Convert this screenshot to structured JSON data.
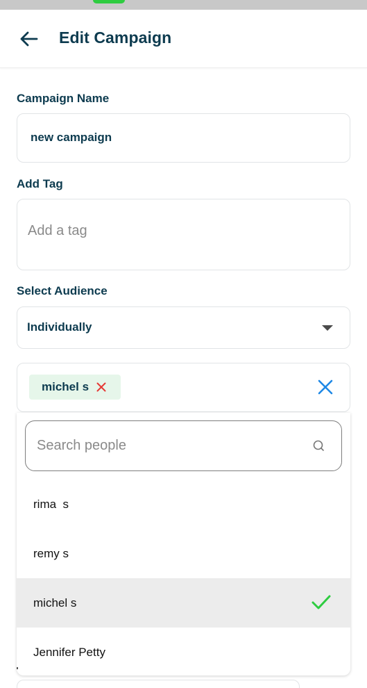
{
  "header": {
    "title": "Edit Campaign",
    "back_icon": "arrow-left-icon"
  },
  "form": {
    "campaign_name": {
      "label": "Campaign Name",
      "value": "new campaign"
    },
    "tag": {
      "label": "Add Tag",
      "placeholder": "Add a tag"
    },
    "audience": {
      "label": "Select Audience",
      "selected": "Individually"
    }
  },
  "selected_people": {
    "chips": [
      {
        "label": "michel s"
      }
    ]
  },
  "people_dropdown": {
    "search_placeholder": "Search people",
    "items": [
      {
        "name": "rima  s",
        "selected": false
      },
      {
        "name": "remy s",
        "selected": false
      },
      {
        "name": "michel s",
        "selected": true
      },
      {
        "name": "Jennifer Petty",
        "selected": false
      }
    ]
  },
  "colors": {
    "primary_text": "#0d3b4f",
    "chip_bg": "#e6f6ea",
    "chip_remove": "#e53935",
    "clear_icon": "#1e88e5",
    "check": "#2ecc40",
    "selected_row_bg": "#ececec"
  }
}
